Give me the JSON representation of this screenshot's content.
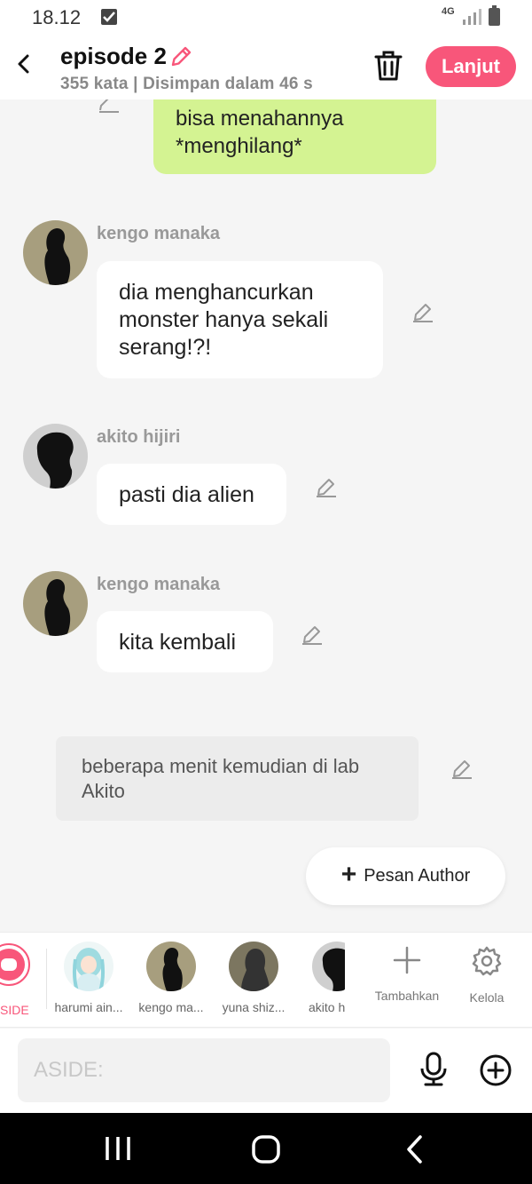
{
  "status": {
    "time": "18.12",
    "network": "4G"
  },
  "header": {
    "title": "episode 2",
    "subtitle": "355 kata | Disimpan dalam 46 s",
    "next_label": "Lanjut"
  },
  "colors": {
    "accent": "#f8567a",
    "green_bubble": "#d4f392"
  },
  "messages": {
    "top": {
      "text": "bisa menahannya *menghilang*"
    },
    "m1": {
      "name": "kengo manaka",
      "text": "dia menghancurkan monster hanya sekali serang!?!"
    },
    "m2": {
      "name": "akito hijiri",
      "text": "pasti dia alien"
    },
    "m3": {
      "name": "kengo manaka",
      "text": "kita kembali"
    },
    "aside": {
      "text": "beberapa menit kemudian di lab Akito"
    }
  },
  "author_button": "Pesan Author",
  "characters": {
    "aside_label": "SIDE",
    "list": [
      "harumi ain...",
      "kengo ma...",
      "yuna shiz...",
      "akito h"
    ],
    "add_label": "Tambahkan",
    "manage_label": "Kelola"
  },
  "input": {
    "placeholder": "ASIDE:"
  }
}
